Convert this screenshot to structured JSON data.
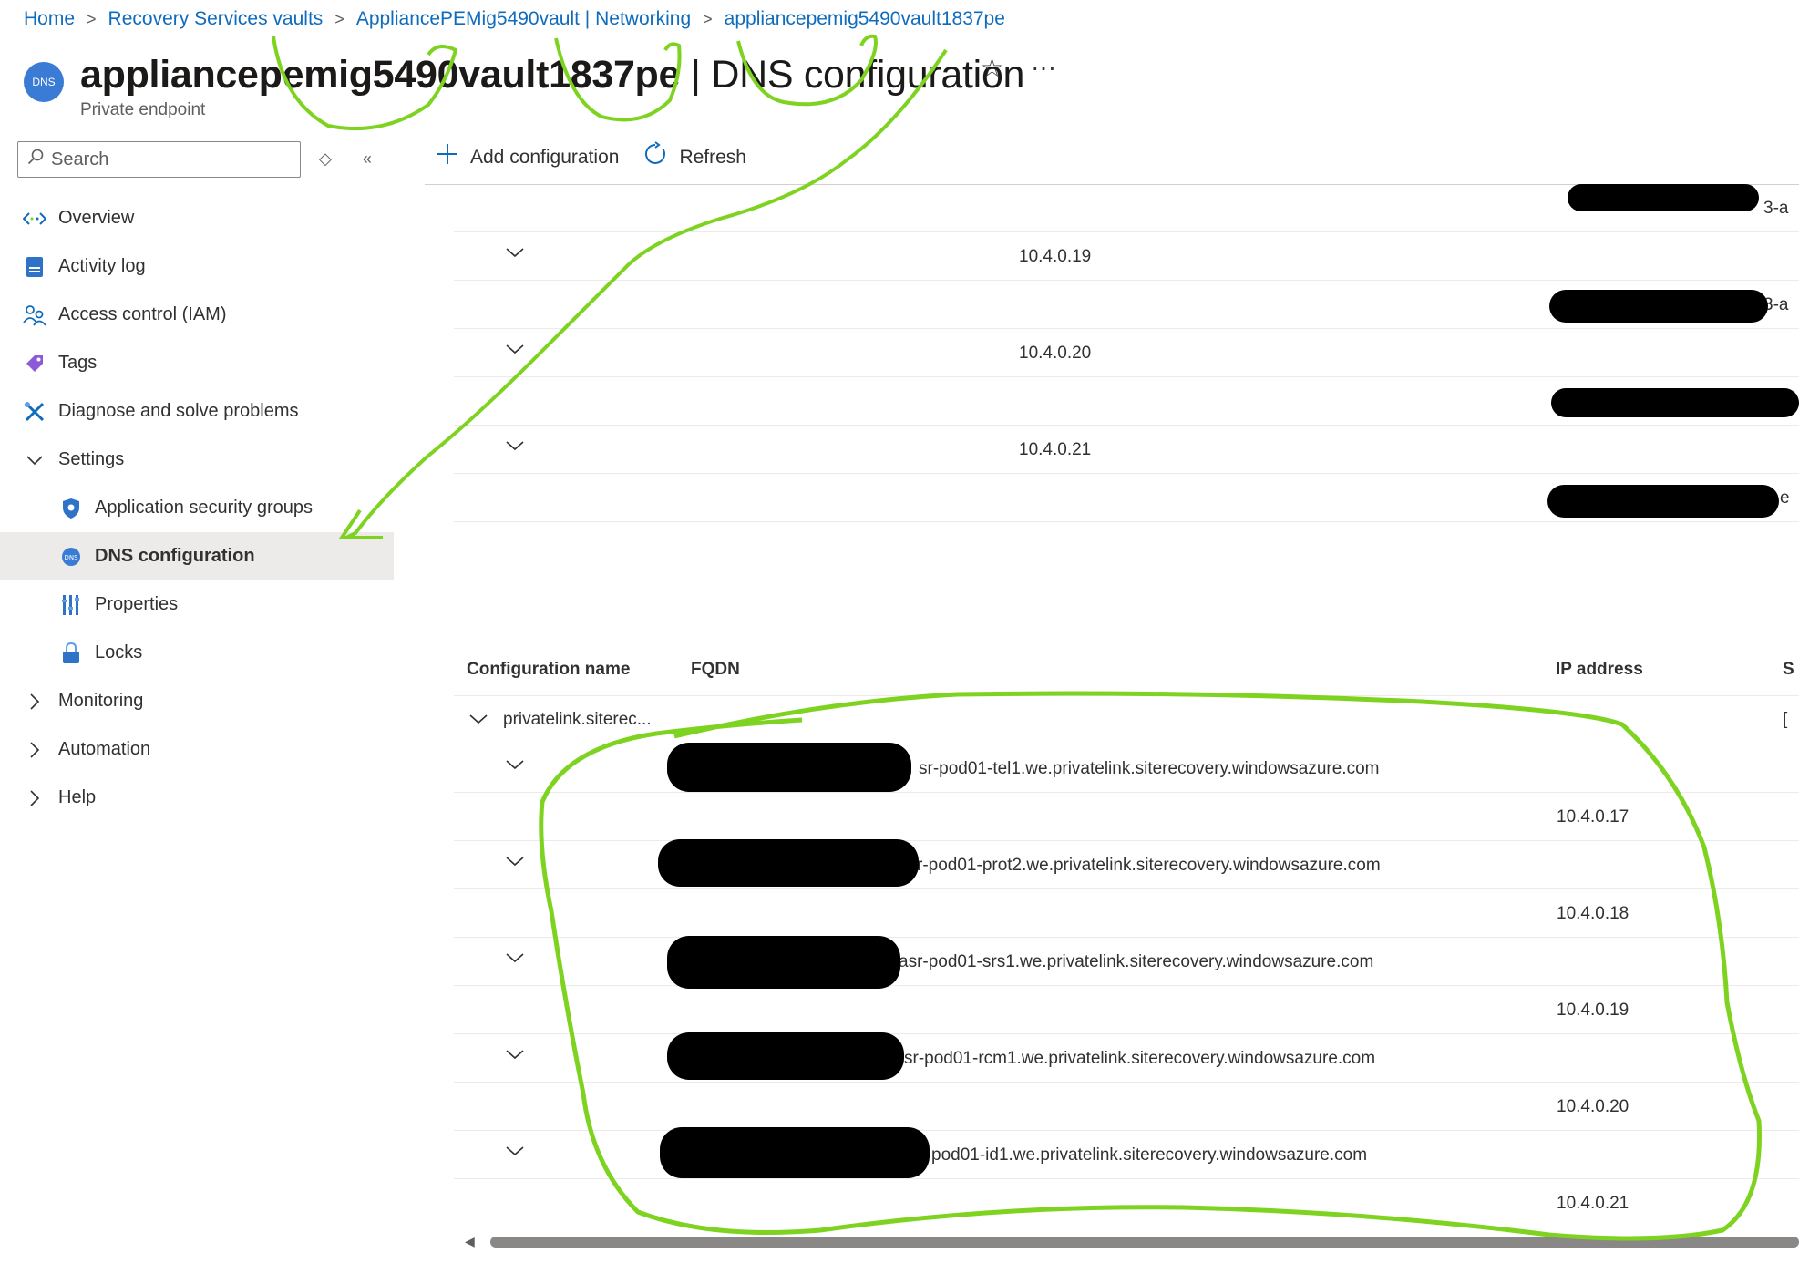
{
  "breadcrumb": {
    "items": [
      "Home",
      "Recovery Services vaults",
      "AppliancePEMig5490vault | Networking",
      "appliancepemig5490vault1837pe"
    ]
  },
  "header": {
    "badge": "DNS",
    "title_resource": "appliancepemig5490vault1837pe",
    "title_page": "| DNS configuration",
    "subtitle": "Private endpoint",
    "star": "☆",
    "more": "···"
  },
  "sidebar": {
    "search_placeholder": "Search",
    "items": [
      {
        "label": "Overview",
        "icon": "overview-icon"
      },
      {
        "label": "Activity log",
        "icon": "activity-log-icon"
      },
      {
        "label": "Access control (IAM)",
        "icon": "iam-icon"
      },
      {
        "label": "Tags",
        "icon": "tag-icon"
      },
      {
        "label": "Diagnose and solve problems",
        "icon": "wrench-icon"
      },
      {
        "label": "Settings",
        "icon": "chevron-down-icon"
      },
      {
        "label": "Application security groups",
        "icon": "shield-icon"
      },
      {
        "label": "DNS configuration",
        "icon": "dns-icon"
      },
      {
        "label": "Properties",
        "icon": "properties-icon"
      },
      {
        "label": "Locks",
        "icon": "lock-icon"
      },
      {
        "label": "Monitoring",
        "icon": "chevron-right-icon"
      },
      {
        "label": "Automation",
        "icon": "chevron-right-icon"
      },
      {
        "label": "Help",
        "icon": "chevron-right-icon"
      }
    ]
  },
  "toolbar": {
    "add_label": "Add configuration",
    "refresh_label": "Refresh"
  },
  "top_grid": {
    "partial_right": [
      "3-a",
      "3-a",
      "",
      "e"
    ],
    "ips": [
      "10.4.0.19",
      "10.4.0.20",
      "10.4.0.21"
    ]
  },
  "bottom_grid": {
    "headers": {
      "config_name": "Configuration name",
      "fqdn": "FQDN",
      "ip": "IP address",
      "cut": "S"
    },
    "group_label": "privatelink.siterec...",
    "group_right": "[",
    "rows": [
      {
        "fqdn": "sr-pod01-tel1.we.privatelink.siterecovery.windowsazure.com",
        "ip": "10.4.0.17"
      },
      {
        "fqdn": "r-pod01-prot2.we.privatelink.siterecovery.windowsazure.com",
        "ip": "10.4.0.18"
      },
      {
        "fqdn": "asr-pod01-srs1.we.privatelink.siterecovery.windowsazure.com",
        "ip": "10.4.0.19"
      },
      {
        "fqdn": "sr-pod01-rcm1.we.privatelink.siterecovery.windowsazure.com",
        "ip": "10.4.0.20"
      },
      {
        "fqdn": "pod01-id1.we.privatelink.siterecovery.windowsazure.com",
        "ip": "10.4.0.21"
      }
    ]
  },
  "colors": {
    "link": "#0f6cbd",
    "annotation": "#7ed321",
    "redaction": "#000000"
  }
}
